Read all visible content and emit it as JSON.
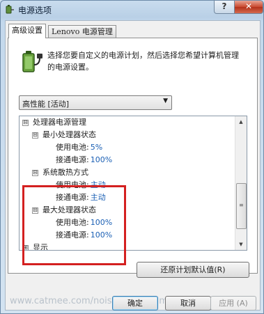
{
  "window": {
    "title": "电源选项",
    "help_label": "?",
    "close_label": "✕",
    "icon": "power-options-icon"
  },
  "tabs": [
    {
      "label": "高级设置",
      "active": true
    },
    {
      "label": "Lenovo 电源管理",
      "active": false
    }
  ],
  "intro": {
    "icon": "battery-plug-icon",
    "text": "选择您要自定义的电源计划，然后选择您希望计算机管理的电源设置。"
  },
  "plan": {
    "selected": "高性能 [活动]"
  },
  "tree": {
    "root": {
      "label": "处理器电源管理",
      "expander": "⊟"
    },
    "min_state": {
      "label": "最小处理器状态",
      "expander": "⊟",
      "battery_label": "使用电池:",
      "battery_value": "5%",
      "plugged_label": "接通电源:",
      "plugged_value": "100%"
    },
    "cooling": {
      "label": "系统散热方式",
      "expander": "⊟",
      "battery_label": "使用电池:",
      "battery_value": "主动",
      "plugged_label": "接通电源:",
      "plugged_value": "主动"
    },
    "max_state": {
      "label": "最大处理器状态",
      "expander": "⊟",
      "battery_label": "使用电池:",
      "battery_value": "100%",
      "plugged_label": "接通电源:",
      "plugged_value": "100%"
    },
    "display": {
      "label": "显示",
      "expander": "⊞"
    }
  },
  "buttons": {
    "restore": "还原计划默认值(R)",
    "ok": "确定",
    "cancel": "取消",
    "apply": "应用 (A)"
  },
  "watermark": "www.catmee.com/noise-while-gaming/",
  "colors": {
    "highlight_border": "#d42020",
    "value_text": "#1a5fb4"
  }
}
